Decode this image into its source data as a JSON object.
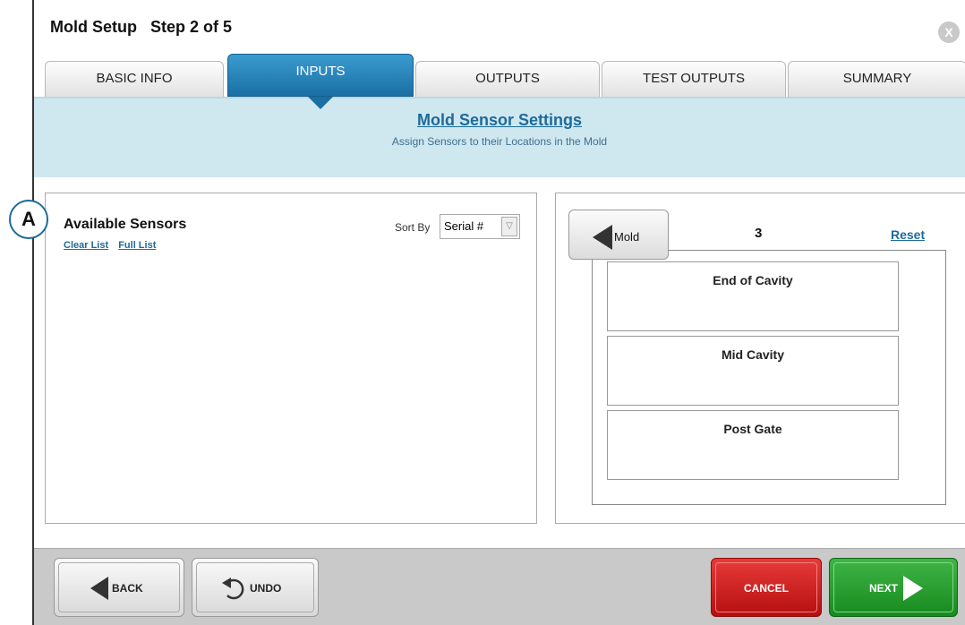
{
  "window": {
    "title": "Mold Setup   Step 2 of 5",
    "close_label": "X"
  },
  "tabs": [
    {
      "label": "BASIC INFO",
      "active": false
    },
    {
      "label": "INPUTS",
      "active": true
    },
    {
      "label": "OUTPUTS",
      "active": false
    },
    {
      "label": "TEST OUTPUTS",
      "active": false
    },
    {
      "label": "SUMMARY",
      "active": false
    }
  ],
  "banner": {
    "title": "Mold Sensor Settings",
    "subtitle": "Assign Sensors to their Locations in the Mold"
  },
  "callout": {
    "label": "A"
  },
  "available": {
    "title": "Available Sensors",
    "clear_label": "Clear List",
    "full_label": "Full List",
    "sort_label": "Sort By",
    "sort_value": "Serial #"
  },
  "mold": {
    "button_label": "Mold",
    "count": "3",
    "reset_label": "Reset",
    "locations": [
      "End of Cavity",
      "Mid Cavity",
      "Post Gate"
    ]
  },
  "footer": {
    "back_label": "BACK",
    "undo_label": "UNDO",
    "cancel_label": "CANCEL",
    "next_label": "NEXT"
  },
  "colors": {
    "accent": "#1d6b9a",
    "tab_active": "#1a6fa3",
    "banner_bg": "#cfe7ef",
    "cancel": "#c41515",
    "next": "#1f9327"
  }
}
